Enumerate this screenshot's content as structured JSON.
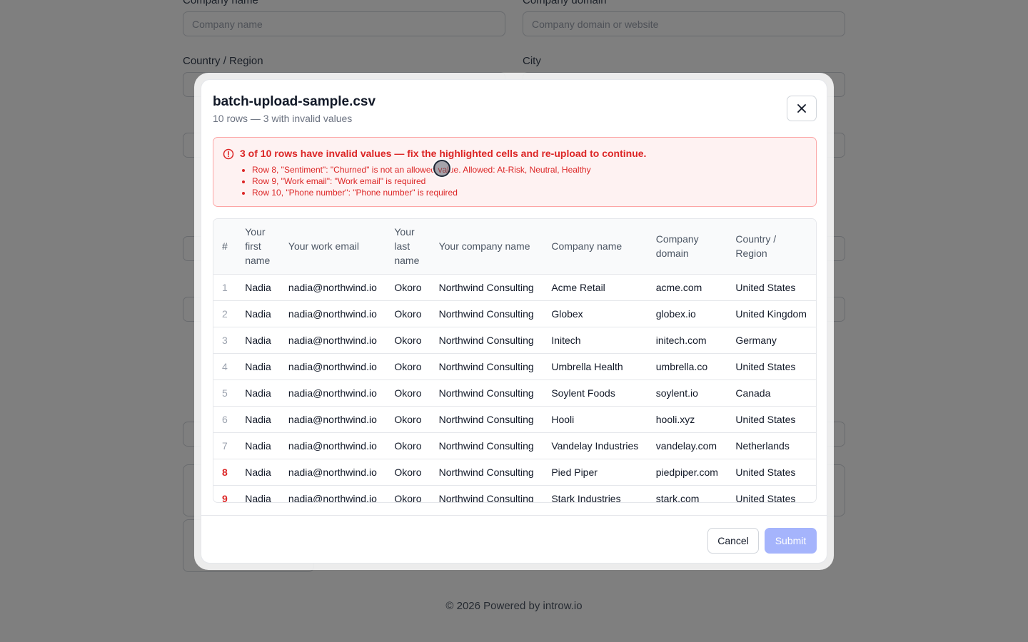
{
  "background": {
    "company_name_label": "Company name",
    "company_name_placeholder": "Company name",
    "company_domain_label": "Company domain",
    "company_domain_placeholder": "Company domain or website",
    "country_label": "Country / Region",
    "city_label": "City",
    "footer": "© 2026 Powered by introw.io"
  },
  "modal": {
    "title": "batch-upload-sample.csv",
    "subtitle": "10 rows — 3 with invalid values",
    "close_icon": "close-icon",
    "alert": {
      "icon": "alert-circle-icon",
      "title": "3 of 10 rows have invalid values — fix the highlighted cells and re-upload to continue.",
      "errors": [
        "Row 8, \"Sentiment\": \"Churned\" is not an allowed value. Allowed: At-Risk, Neutral, Healthy",
        "Row 9, \"Work email\": \"Work email\" is required",
        "Row 10, \"Phone number\": \"Phone number\" is required"
      ]
    },
    "table": {
      "columns": [
        "#",
        "Your first name",
        "Your work email",
        "Your last name",
        "Your company name",
        "Company name",
        "Company domain",
        "Country / Region"
      ],
      "rows": [
        [
          "1",
          "Nadia",
          "nadia@northwind.io",
          "Okoro",
          "Northwind Consulting",
          "Acme Retail",
          "acme.com",
          "United States"
        ],
        [
          "2",
          "Nadia",
          "nadia@northwind.io",
          "Okoro",
          "Northwind Consulting",
          "Globex",
          "globex.io",
          "United Kingdom"
        ],
        [
          "3",
          "Nadia",
          "nadia@northwind.io",
          "Okoro",
          "Northwind Consulting",
          "Initech",
          "initech.com",
          "Germany"
        ],
        [
          "4",
          "Nadia",
          "nadia@northwind.io",
          "Okoro",
          "Northwind Consulting",
          "Umbrella Health",
          "umbrella.co",
          "United States"
        ],
        [
          "5",
          "Nadia",
          "nadia@northwind.io",
          "Okoro",
          "Northwind Consulting",
          "Soylent Foods",
          "soylent.io",
          "Canada"
        ],
        [
          "6",
          "Nadia",
          "nadia@northwind.io",
          "Okoro",
          "Northwind Consulting",
          "Hooli",
          "hooli.xyz",
          "United States"
        ],
        [
          "7",
          "Nadia",
          "nadia@northwind.io",
          "Okoro",
          "Northwind Consulting",
          "Vandelay Industries",
          "vandelay.com",
          "Netherlands"
        ],
        [
          "8",
          "Nadia",
          "nadia@northwind.io",
          "Okoro",
          "Northwind Consulting",
          "Pied Piper",
          "piedpiper.com",
          "United States"
        ],
        [
          "9",
          "Nadia",
          "nadia@northwind.io",
          "Okoro",
          "Northwind Consulting",
          "Stark Industries",
          "stark.com",
          "United States"
        ]
      ],
      "invalid_rows": [
        "8",
        "9"
      ]
    },
    "footer": {
      "cancel_label": "Cancel",
      "submit_label": "Submit"
    }
  },
  "colors": {
    "error": "#dc2626",
    "error_bg": "#fef2f2",
    "submit_disabled": "#a5b4fc"
  }
}
